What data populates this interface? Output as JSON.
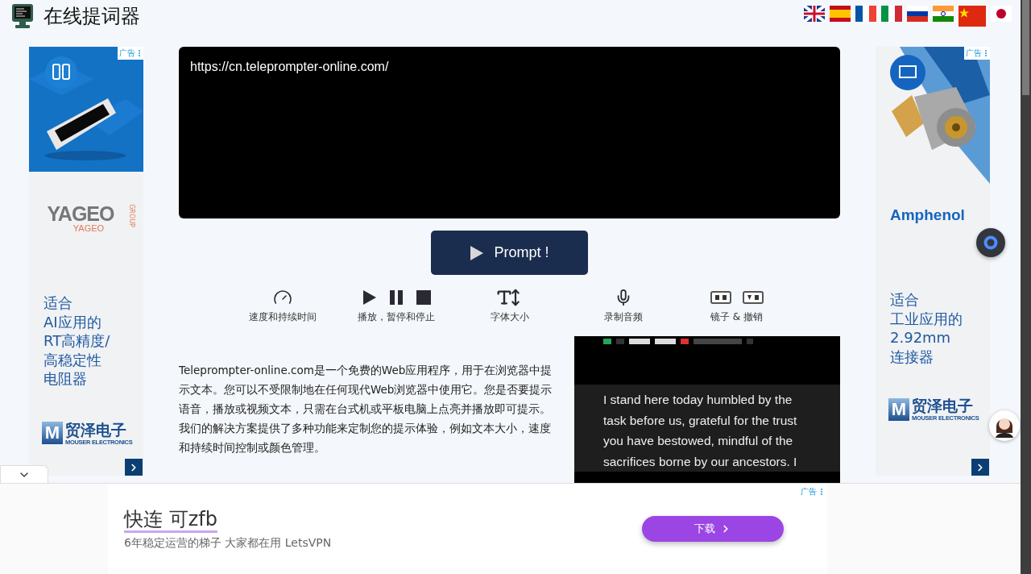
{
  "header": {
    "title": "在线提词器"
  },
  "left_ad": {
    "badge": "广告",
    "brand": "YAGEO",
    "brand_sub": "YAGEO",
    "brand_group": "GROUP",
    "headline": [
      "适合",
      "AI应用的",
      "RT高精度/",
      "高稳定性",
      "电阻器"
    ],
    "logo_mark": "M",
    "logo_name": "贸泽电子",
    "logo_sub": "MOUSER ELECTRONICS"
  },
  "editor": {
    "value": "https://cn.teleprompter-online.com/"
  },
  "prompt_button": {
    "label": "Prompt !"
  },
  "toolbar": [
    {
      "kind": "speed",
      "label": "速度和持续时间"
    },
    {
      "kind": "playback",
      "label": "播放，暂停和停止"
    },
    {
      "kind": "font",
      "label": "字体大小"
    },
    {
      "kind": "record",
      "label": "录制音频"
    },
    {
      "kind": "mirror",
      "label": "镜子 & 撤销"
    }
  ],
  "description": "Teleprompter-online.com是一个免费的Web应用程序，用于在浏览器中提示文本。您可以不受限制地在任何现代Web浏览器中使用它。您是否要提示语音，播放或视频文本，只需在台式机或平板电脑上点亮并播放即可提示。我们的解决方案提供了多种功能来定制您的提示体验，例如文本大小，速度和持续时间控制或颜色管理。",
  "preview": {
    "lines": [
      "I stand here today humbled by the",
      "task before us, grateful for the trust",
      "you have bestowed, mindful of the",
      "sacrifices borne by our ancestors. I"
    ]
  },
  "right_ad": {
    "badge": "广告",
    "brand": "Amphenol",
    "headline": [
      "适合",
      "工业应用的",
      "2.92mm",
      "连接器"
    ],
    "logo_mark": "M",
    "logo_name": "贸泽电子",
    "logo_sub": "MOUSER ELECTRONICS"
  },
  "bottom_ad": {
    "badge": "广告",
    "title": "快连 可zfb",
    "subtitle": "6年稳定运营的梯子 大家都在用 LetsVPN",
    "button": "下载"
  }
}
